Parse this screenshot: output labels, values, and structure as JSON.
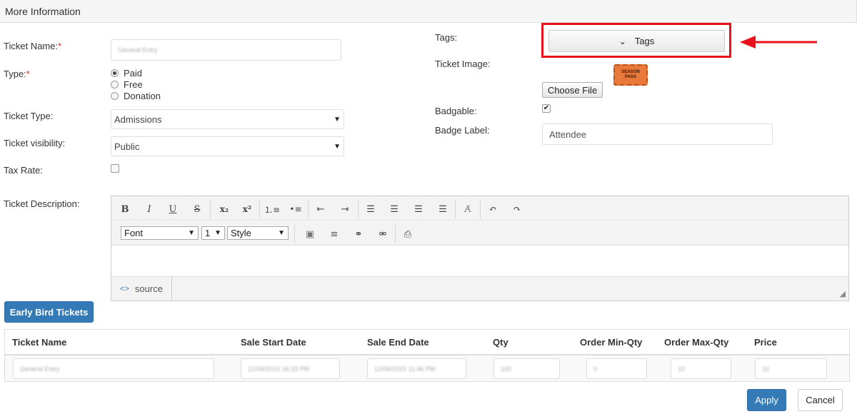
{
  "header": {
    "title": "More Information"
  },
  "form": {
    "ticket_name": {
      "label": "Ticket Name:",
      "required_mark": "*",
      "value": "General Entry"
    },
    "type": {
      "label": "Type:",
      "required_mark": "*",
      "options": [
        "Paid",
        "Free",
        "Donation"
      ],
      "selected": "Paid"
    },
    "ticket_type": {
      "label": "Ticket Type:",
      "value": "Admissions"
    },
    "ticket_visibility": {
      "label": "Ticket visibility:",
      "value": "Public"
    },
    "tax_rate": {
      "label": "Tax Rate:",
      "checked": false
    },
    "description": {
      "label": "Ticket Description:"
    }
  },
  "right": {
    "tags": {
      "label": "Tags:",
      "button_label": "Tags",
      "highlight_color": "#e8101b"
    },
    "ticket_image": {
      "label": "Ticket Image:",
      "image_line1": "SEASON",
      "image_line2": "PASS",
      "choose_file_label": "Choose File"
    },
    "badgable": {
      "label": "Badgable:",
      "checked": true
    },
    "badge_label": {
      "label": "Badge Label:",
      "value": "Attendee"
    }
  },
  "editor": {
    "font_select": "Font",
    "size_select": "1",
    "style_select": "Style",
    "source_label": "source"
  },
  "early_bird_button": "Early Bird Tickets",
  "table": {
    "headers": [
      "Ticket Name",
      "Sale Start Date",
      "Sale End Date",
      "Qty",
      "Order Min-Qty",
      "Order Max-Qty",
      "Price"
    ],
    "row": [
      "General Entry",
      "12/06/2015 16:33 PM",
      "12/06/2015 11:46 PM",
      "100",
      "0",
      "10",
      "10"
    ]
  },
  "actions": {
    "apply": "Apply",
    "cancel": "Cancel"
  },
  "colors": {
    "primary": "#337ab7",
    "required": "#d9342b",
    "arrow": "#e8101b",
    "ticket_orange": "#e8793a"
  }
}
